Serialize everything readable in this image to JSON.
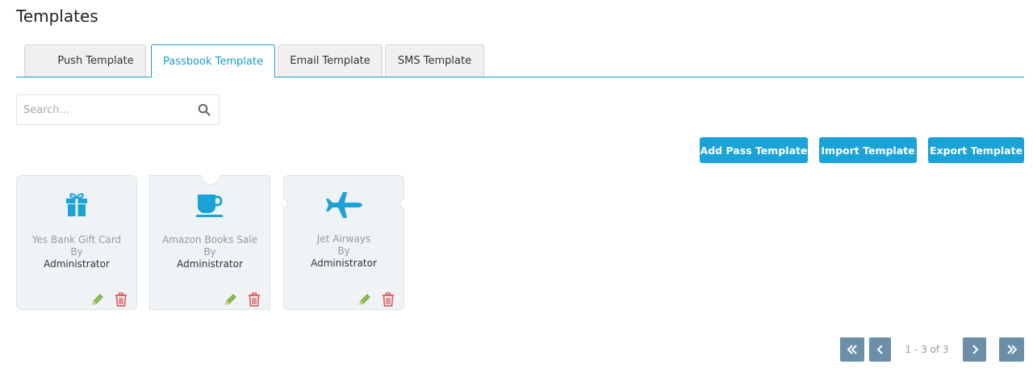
{
  "page": {
    "title": "Templates"
  },
  "tabs": [
    {
      "label": "Push Template",
      "active": false
    },
    {
      "label": "Passbook Template",
      "active": true
    },
    {
      "label": "Email Template",
      "active": false
    },
    {
      "label": "SMS Template",
      "active": false
    }
  ],
  "search": {
    "placeholder": "Search...",
    "value": "",
    "icon": "search-icon"
  },
  "toolbar": {
    "add_label": "Add Pass Template",
    "import_label": "Import Template",
    "export_label": "Export Template"
  },
  "cards": [
    {
      "name": "Yes Bank Gift Card",
      "by": "By",
      "author": "Administrator",
      "icon": "gift-icon"
    },
    {
      "name": "Amazon Books Sale",
      "by": "By",
      "author": "Administrator",
      "icon": "coffee-cup-icon"
    },
    {
      "name": "Jet Airways",
      "by": "By",
      "author": "Administrator",
      "icon": "airplane-icon"
    }
  ],
  "pagination": {
    "text": "1 - 3 of 3"
  },
  "colors": {
    "accent": "#1aa3d6",
    "tab_active": "#1a9bc9",
    "edit_icon": "#7cc04b",
    "delete_icon": "#d9534f",
    "pager": "#6b8fa8"
  }
}
